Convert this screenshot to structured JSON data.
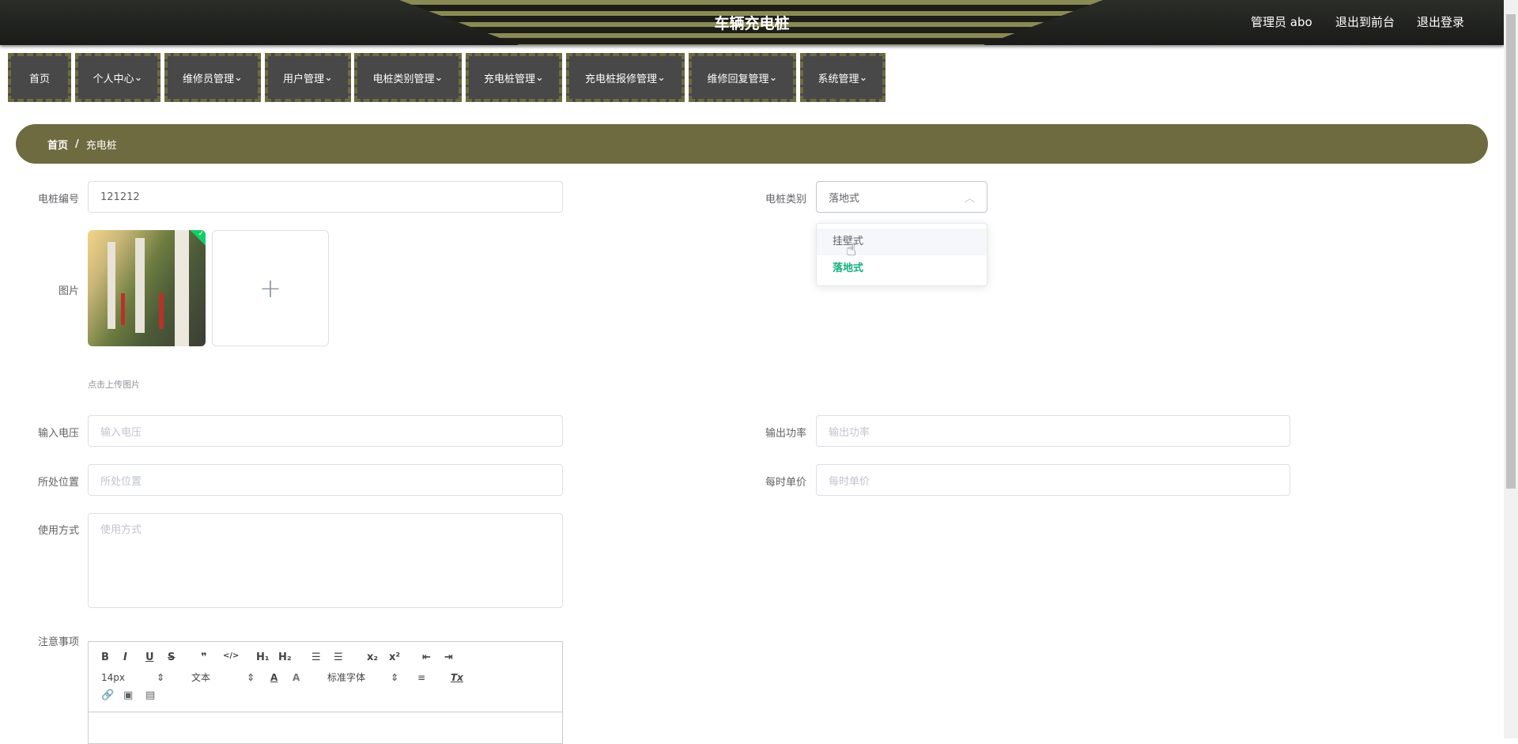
{
  "header": {
    "title": "车辆充电桩",
    "user": "管理员 abo",
    "front": "退出到前台",
    "logout": "退出登录"
  },
  "nav": [
    "首页",
    "个人中心",
    "维修员管理",
    "用户管理",
    "电桩类别管理",
    "充电桩管理",
    "充电桩报修管理",
    "维修回复管理",
    "系统管理"
  ],
  "breadcrumb": {
    "home": "首页",
    "sep": "/",
    "current": "充电桩"
  },
  "form": {
    "code": {
      "label": "电桩编号",
      "value": "121212"
    },
    "category": {
      "label": "电桩类别",
      "value": "落地式",
      "options": [
        "挂壁式",
        "落地式"
      ],
      "hovered": "挂壁式",
      "selected": "落地式"
    },
    "image": {
      "label": "图片",
      "hint": "点击上传图片"
    },
    "voltage": {
      "label": "输入电压",
      "placeholder": "输入电压"
    },
    "power": {
      "label": "输出功率",
      "placeholder": "输出功率"
    },
    "location": {
      "label": "所处位置",
      "placeholder": "所处位置"
    },
    "price": {
      "label": "每时单价",
      "placeholder": "每时单价"
    },
    "usage": {
      "label": "使用方式",
      "placeholder": "使用方式"
    },
    "notes": {
      "label": "注意事项",
      "size": "14px",
      "header": "文本",
      "font": "标准字体"
    }
  },
  "colors": {
    "accent": "#6e6b40",
    "selected": "#13b07c"
  }
}
